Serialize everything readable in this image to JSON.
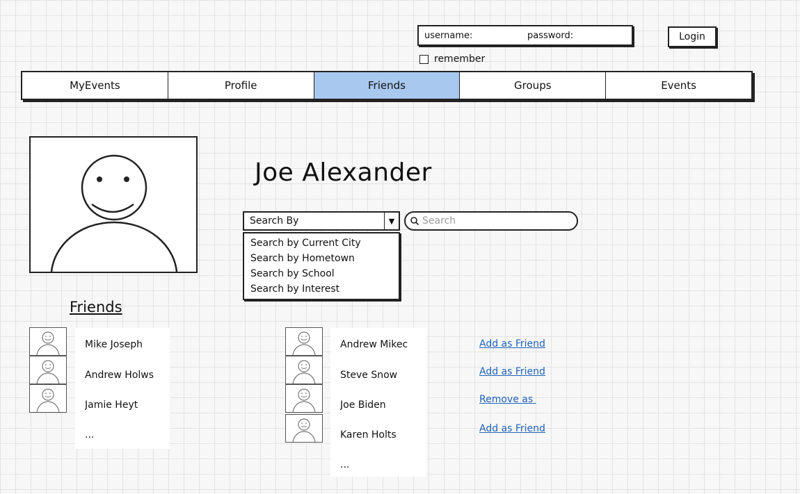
{
  "login": {
    "username_label": "username:",
    "password_label": "password:",
    "remember_label": "remember",
    "login_button": "Login"
  },
  "nav": {
    "tabs": [
      {
        "label": "MyEvents",
        "active": false
      },
      {
        "label": "Profile",
        "active": false
      },
      {
        "label": "Friends",
        "active": true
      },
      {
        "label": "Groups",
        "active": false
      },
      {
        "label": "Events",
        "active": false
      }
    ],
    "active_color": "#a9c8ef"
  },
  "profile": {
    "name": "Joe Alexander",
    "image_icon": "smiley-face-icon"
  },
  "search": {
    "search_by_label": "Search By",
    "options": [
      "Search by Current City",
      "Search by Hometown",
      "Search by School",
      "Search by Interest"
    ],
    "placeholder": "Search"
  },
  "friends": {
    "heading": "Friends",
    "list": [
      "Mike Joseph",
      "Andrew Holws",
      "Jamie Heyt",
      "..."
    ]
  },
  "results": {
    "list": [
      {
        "name": "Andrew Mikec",
        "action": "Add as Friend"
      },
      {
        "name": "Steve Snow",
        "action": "Add as Friend"
      },
      {
        "name": "Joe Biden",
        "action": "Remove as "
      },
      {
        "name": "Karen Holts",
        "action": "Add as Friend"
      },
      {
        "name": "...",
        "action": ""
      }
    ],
    "link_color": "#1f63b8"
  }
}
